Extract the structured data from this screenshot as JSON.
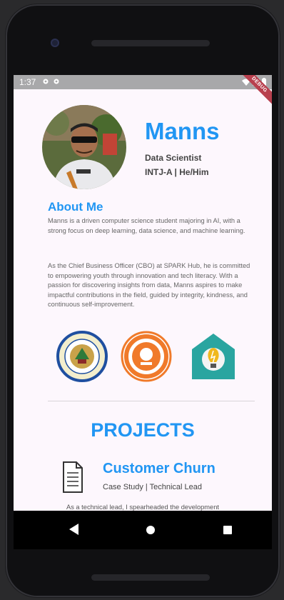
{
  "status_bar": {
    "time": "1:37",
    "debug_banner": "DEBUG"
  },
  "profile": {
    "name": "Manns",
    "role": "Data Scientist",
    "personality": "INTJ-A | He/Him"
  },
  "about": {
    "title": "About Me",
    "paragraph1": "Manns is a driven computer science student majoring in AI, with a strong focus on deep learning, data science, and machine learning.",
    "paragraph2": "As the Chief Business Officer (CBO) at SPARK Hub, he is committed to empowering youth through innovation and tech literacy. With a passion for discovering insights from data, Manns aspires to make impactful contributions in the field, guided by integrity, kindness, and continuous self-improvement."
  },
  "logos": [
    {
      "icon": "university-seal-logo",
      "color": "#1f4fa0"
    },
    {
      "icon": "org-seal-logo",
      "color": "#f07a2a"
    },
    {
      "icon": "spark-hub-logo",
      "color": "#2aa5a0"
    }
  ],
  "projects": {
    "title": "PROJECTS",
    "items": [
      {
        "icon": "document-icon",
        "name": "Customer Churn",
        "meta": "Case Study | Technical Lead",
        "description": "As a technical lead, I spearheaded the development"
      }
    ]
  },
  "colors": {
    "accent": "#2196f3",
    "background": "#fdf7fd"
  }
}
